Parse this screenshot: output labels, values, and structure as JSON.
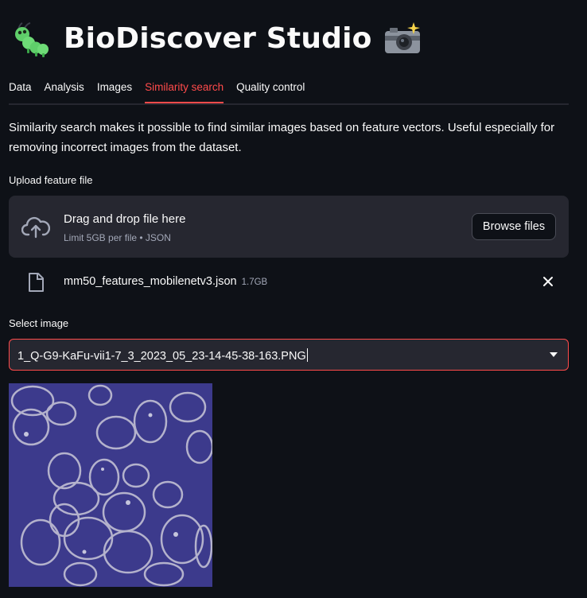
{
  "app": {
    "title": "BioDiscover Studio",
    "title_icon": "caterpillar-icon",
    "title_suffix_icon": "camera-flash-icon"
  },
  "tabs": [
    {
      "label": "Data",
      "active": false
    },
    {
      "label": "Analysis",
      "active": false
    },
    {
      "label": "Images",
      "active": false
    },
    {
      "label": "Similarity search",
      "active": true
    },
    {
      "label": "Quality control",
      "active": false
    }
  ],
  "description": "Similarity search makes it possible to find similar images based on feature vectors. Useful especially for removing incorrect images from the dataset.",
  "upload": {
    "label": "Upload feature file",
    "drop_title": "Drag and drop file here",
    "drop_hint": "Limit 5GB per file • JSON",
    "browse_label": "Browse files",
    "uploaded_file": {
      "name": "mm50_features_mobilenetv3.json",
      "size": "1.7GB"
    }
  },
  "select_image": {
    "label": "Select image",
    "value": "1_Q-G9-KaFu-vii1-7_3_2023_05_23-14-45-38-163.PNG"
  },
  "colors": {
    "background": "#0e1117",
    "accent": "#ff4b4b",
    "surface": "#262730",
    "text": "#fafafa",
    "muted": "#a3a8b8",
    "image_background": "#3c3a8c"
  }
}
